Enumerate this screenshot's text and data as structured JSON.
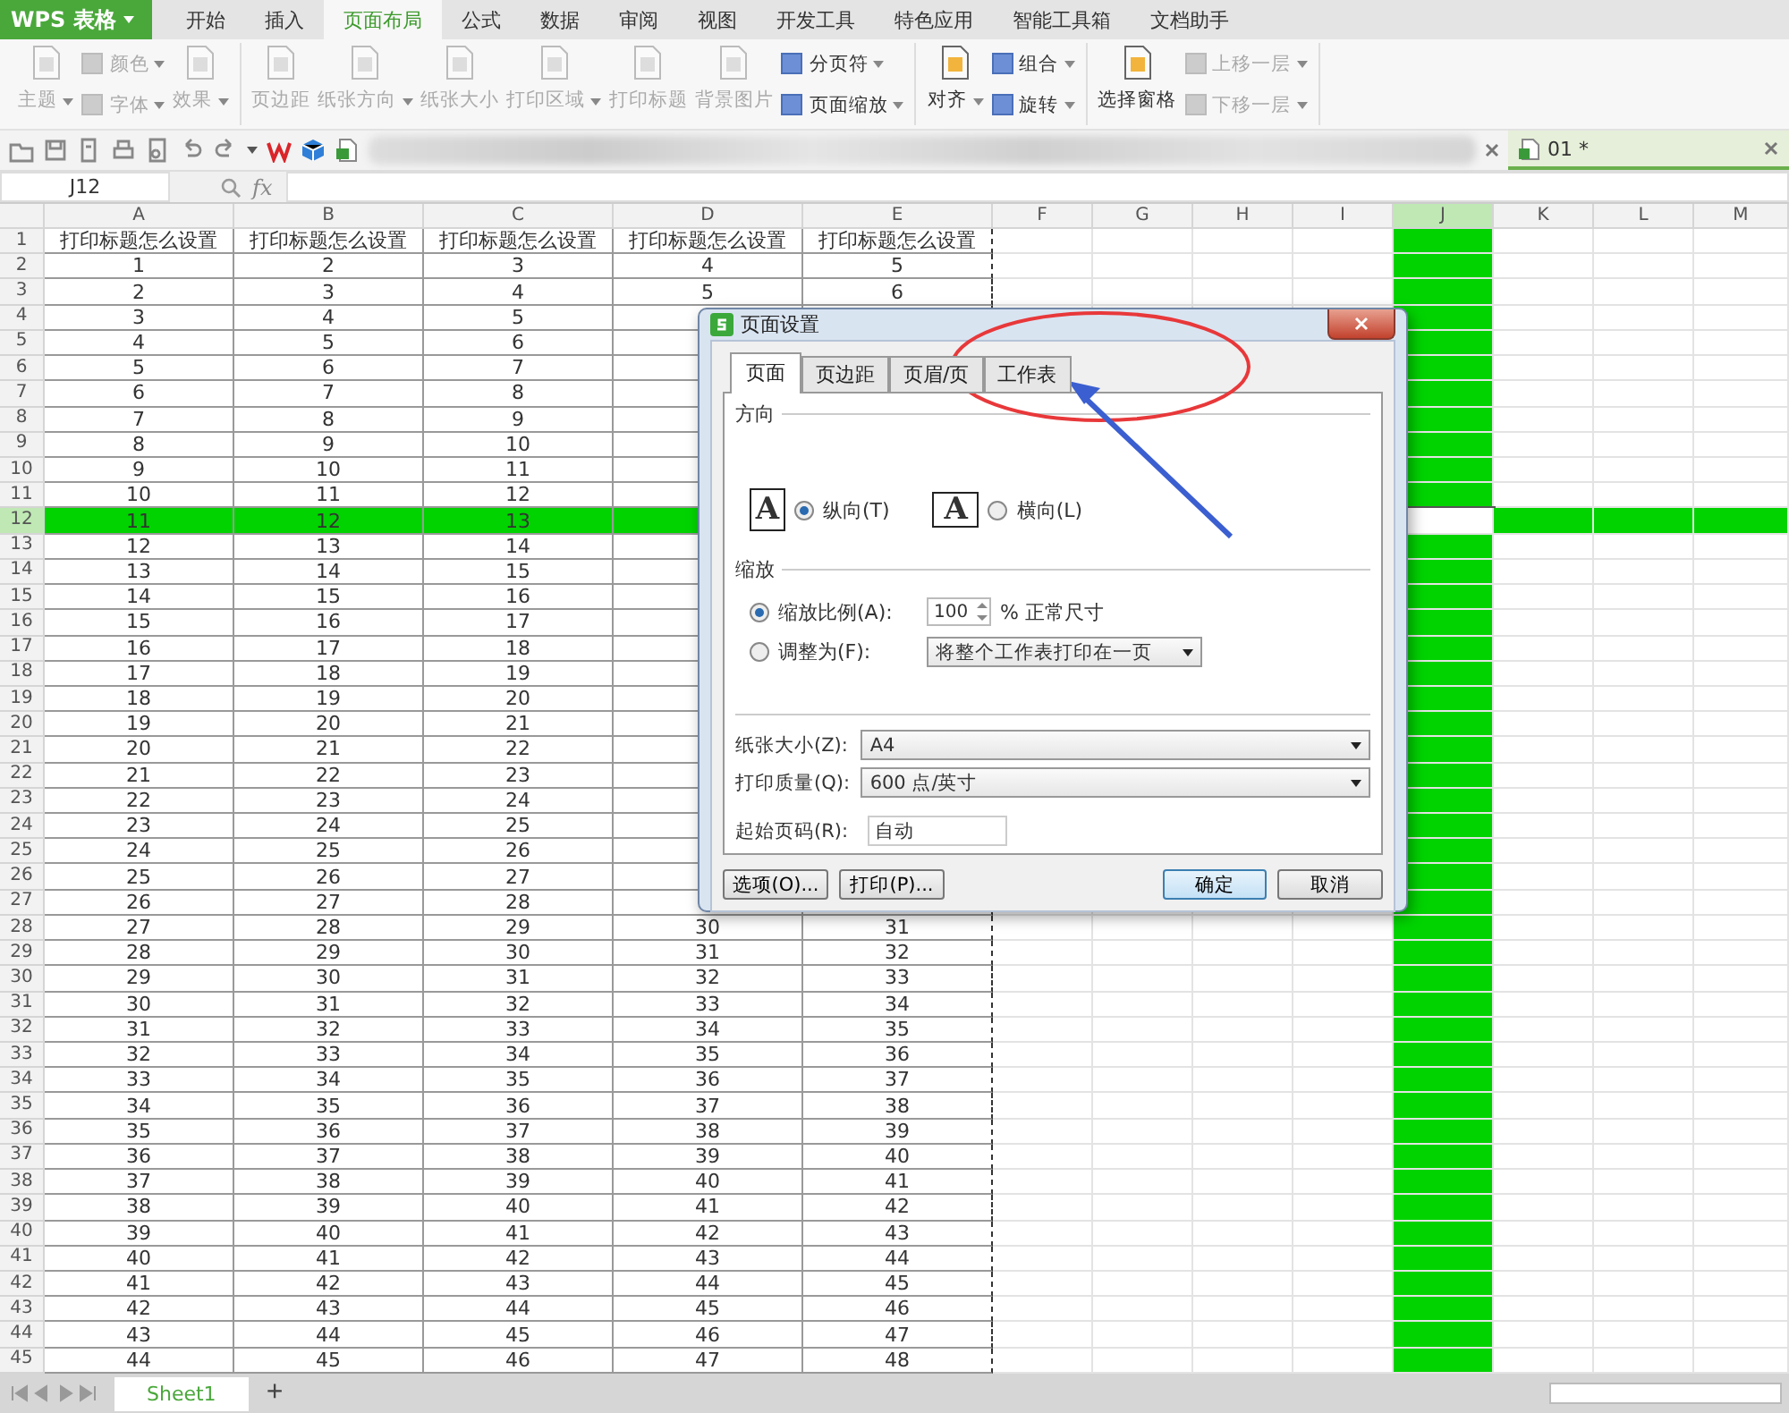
{
  "app_button": {
    "label": "WPS 表格"
  },
  "menu_tabs": [
    {
      "label": "开始",
      "selected": false
    },
    {
      "label": "插入",
      "selected": false
    },
    {
      "label": "页面布局",
      "selected": true
    },
    {
      "label": "公式",
      "selected": false
    },
    {
      "label": "数据",
      "selected": false
    },
    {
      "label": "审阅",
      "selected": false
    },
    {
      "label": "视图",
      "selected": false
    },
    {
      "label": "开发工具",
      "selected": false
    },
    {
      "label": "特色应用",
      "selected": false
    },
    {
      "label": "智能工具箱",
      "selected": false
    },
    {
      "label": "文档助手",
      "selected": false
    }
  ],
  "ribbon": {
    "groups": [
      {
        "columns": [
          [
            {
              "label": "主题",
              "disabled": true,
              "menu": true
            }
          ],
          [
            {
              "label": "颜色",
              "disabled": true,
              "menu": true
            },
            {
              "label": "字体",
              "disabled": true,
              "menu": true
            }
          ],
          [
            {
              "label": "效果",
              "disabled": true,
              "menu": true
            }
          ]
        ]
      },
      {
        "columns": [
          [
            {
              "label": "页边距",
              "disabled": true,
              "menu": false
            }
          ],
          [
            {
              "label": "纸张方向",
              "disabled": true,
              "menu": true
            }
          ],
          [
            {
              "label": "纸张大小",
              "disabled": true,
              "menu": false
            }
          ],
          [
            {
              "label": "打印区域",
              "disabled": true,
              "menu": true
            }
          ],
          [
            {
              "label": "打印标题",
              "disabled": true,
              "menu": false
            }
          ],
          [
            {
              "label": "背景图片",
              "disabled": true,
              "menu": false
            }
          ],
          [
            {
              "label": "分页符",
              "disabled": false,
              "menu": true
            },
            {
              "label": "页面缩放",
              "disabled": false,
              "menu": true
            }
          ]
        ]
      },
      {
        "columns": [
          [
            {
              "label": "对齐",
              "disabled": false,
              "menu": true
            }
          ],
          [
            {
              "label": "组合",
              "disabled": false,
              "menu": true
            },
            {
              "label": "旋转",
              "disabled": false,
              "menu": true
            }
          ]
        ]
      },
      {
        "columns": [
          [
            {
              "label": "选择窗格",
              "disabled": false,
              "menu": false
            }
          ],
          [
            {
              "label": "上移一层",
              "disabled": true,
              "menu": true
            },
            {
              "label": "下移一层",
              "disabled": true,
              "menu": true
            }
          ]
        ]
      }
    ]
  },
  "document_tab": {
    "label": "01 *"
  },
  "name_box": {
    "value": "J12"
  },
  "formula_bar": {
    "fx": "fx"
  },
  "sheet": {
    "columns": [
      {
        "label": "A",
        "selected": false
      },
      {
        "label": "B",
        "selected": false
      },
      {
        "label": "C",
        "selected": false
      },
      {
        "label": "D",
        "selected": false
      },
      {
        "label": "E",
        "selected": false
      },
      {
        "label": "F",
        "selected": false
      },
      {
        "label": "G",
        "selected": false
      },
      {
        "label": "H",
        "selected": false
      },
      {
        "label": "I",
        "selected": false
      },
      {
        "label": "J",
        "selected": true
      },
      {
        "label": "K",
        "selected": false
      },
      {
        "label": "L",
        "selected": false
      },
      {
        "label": "M",
        "selected": false
      }
    ],
    "rows": [
      {
        "header": "1",
        "selected": false,
        "cells": [
          "打印标题怎么设置",
          "打印标题怎么设置",
          "打印标题怎么设置",
          "打印标题怎么设置",
          "打印标题怎么设置"
        ]
      },
      {
        "header": "2",
        "selected": false,
        "cells": [
          "1",
          "2",
          "3",
          "4",
          "5"
        ]
      },
      {
        "header": "3",
        "selected": false,
        "cells": [
          "2",
          "3",
          "4",
          "5",
          "6"
        ]
      },
      {
        "header": "4",
        "selected": false,
        "cells": [
          "3",
          "4",
          "5"
        ]
      },
      {
        "header": "5",
        "selected": false,
        "cells": [
          "4",
          "5",
          "6"
        ]
      },
      {
        "header": "6",
        "selected": false,
        "cells": [
          "5",
          "6",
          "7"
        ]
      },
      {
        "header": "7",
        "selected": false,
        "cells": [
          "6",
          "7",
          "8"
        ]
      },
      {
        "header": "8",
        "selected": false,
        "cells": [
          "7",
          "8",
          "9"
        ]
      },
      {
        "header": "9",
        "selected": false,
        "cells": [
          "8",
          "9",
          "10"
        ]
      },
      {
        "header": "10",
        "selected": false,
        "cells": [
          "9",
          "10",
          "11"
        ]
      },
      {
        "header": "11",
        "selected": false,
        "cells": [
          "10",
          "11",
          "12"
        ]
      },
      {
        "header": "12",
        "selected": true,
        "cells": [
          "11",
          "12",
          "13"
        ]
      },
      {
        "header": "13",
        "selected": false,
        "cells": [
          "12",
          "13",
          "14"
        ]
      },
      {
        "header": "14",
        "selected": false,
        "cells": [
          "13",
          "14",
          "15"
        ]
      },
      {
        "header": "15",
        "selected": false,
        "cells": [
          "14",
          "15",
          "16"
        ]
      },
      {
        "header": "16",
        "selected": false,
        "cells": [
          "15",
          "16",
          "17"
        ]
      },
      {
        "header": "17",
        "selected": false,
        "cells": [
          "16",
          "17",
          "18"
        ]
      },
      {
        "header": "18",
        "selected": false,
        "cells": [
          "17",
          "18",
          "19"
        ]
      },
      {
        "header": "19",
        "selected": false,
        "cells": [
          "18",
          "19",
          "20"
        ]
      },
      {
        "header": "20",
        "selected": false,
        "cells": [
          "19",
          "20",
          "21"
        ]
      },
      {
        "header": "21",
        "selected": false,
        "cells": [
          "20",
          "21",
          "22"
        ]
      },
      {
        "header": "22",
        "selected": false,
        "cells": [
          "21",
          "22",
          "23"
        ]
      },
      {
        "header": "23",
        "selected": false,
        "cells": [
          "22",
          "23",
          "24"
        ]
      },
      {
        "header": "24",
        "selected": false,
        "cells": [
          "23",
          "24",
          "25"
        ]
      },
      {
        "header": "25",
        "selected": false,
        "cells": [
          "24",
          "25",
          "26"
        ]
      },
      {
        "header": "26",
        "selected": false,
        "cells": [
          "25",
          "26",
          "27"
        ]
      },
      {
        "header": "27",
        "selected": false,
        "cells": [
          "26",
          "27",
          "28"
        ]
      },
      {
        "header": "28",
        "selected": false,
        "cells": [
          "27",
          "28",
          "29",
          "30",
          "31"
        ]
      },
      {
        "header": "29",
        "selected": false,
        "cells": [
          "28",
          "29",
          "30",
          "31",
          "32"
        ]
      },
      {
        "header": "30",
        "selected": false,
        "cells": [
          "29",
          "30",
          "31",
          "32",
          "33"
        ]
      },
      {
        "header": "31",
        "selected": false,
        "cells": [
          "30",
          "31",
          "32",
          "33",
          "34"
        ]
      },
      {
        "header": "32",
        "selected": false,
        "cells": [
          "31",
          "32",
          "33",
          "34",
          "35"
        ]
      },
      {
        "header": "33",
        "selected": false,
        "cells": [
          "32",
          "33",
          "34",
          "35",
          "36"
        ]
      },
      {
        "header": "34",
        "selected": false,
        "cells": [
          "33",
          "34",
          "35",
          "36",
          "37"
        ]
      },
      {
        "header": "35",
        "selected": false,
        "cells": [
          "34",
          "35",
          "36",
          "37",
          "38"
        ]
      },
      {
        "header": "36",
        "selected": false,
        "cells": [
          "35",
          "36",
          "37",
          "38",
          "39"
        ]
      },
      {
        "header": "37",
        "selected": false,
        "cells": [
          "36",
          "37",
          "38",
          "39",
          "40"
        ]
      },
      {
        "header": "38",
        "selected": false,
        "cells": [
          "37",
          "38",
          "39",
          "40",
          "41"
        ]
      },
      {
        "header": "39",
        "selected": false,
        "cells": [
          "38",
          "39",
          "40",
          "41",
          "42"
        ]
      },
      {
        "header": "40",
        "selected": false,
        "cells": [
          "39",
          "40",
          "41",
          "42",
          "43"
        ]
      },
      {
        "header": "41",
        "selected": false,
        "cells": [
          "40",
          "41",
          "42",
          "43",
          "44"
        ]
      },
      {
        "header": "42",
        "selected": false,
        "cells": [
          "41",
          "42",
          "43",
          "44",
          "45"
        ]
      },
      {
        "header": "43",
        "selected": false,
        "cells": [
          "42",
          "43",
          "44",
          "45",
          "46"
        ]
      },
      {
        "header": "44",
        "selected": false,
        "cells": [
          "43",
          "44",
          "45",
          "46",
          "47"
        ]
      },
      {
        "header": "45",
        "selected": false,
        "cells": [
          "44",
          "45",
          "46",
          "47",
          "48"
        ]
      }
    ]
  },
  "dialog": {
    "title": "页面设置",
    "tabs": [
      {
        "label": "页面",
        "selected": true
      },
      {
        "label": "页边距",
        "selected": false
      },
      {
        "label": "页眉/页",
        "selected": false
      },
      {
        "label": "工作表",
        "selected": false
      }
    ],
    "orientation": {
      "title": "方向",
      "options": [
        {
          "glyph": "A",
          "label": "纵向(T)",
          "selected": true
        },
        {
          "glyph": "A",
          "label": "横向(L)",
          "selected": false
        }
      ]
    },
    "scaling": {
      "title": "缩放",
      "options": [
        {
          "label": "缩放比例(A):",
          "selected": true
        },
        {
          "label": "调整为(F):",
          "selected": false
        }
      ],
      "percent": "100",
      "percent_suffix": "% 正常尺寸",
      "fit": "将整个工作表打印在一页"
    },
    "fields": [
      {
        "label": "纸张大小(Z):",
        "value": "A4"
      },
      {
        "label": "打印质量(Q):",
        "value": "600 点/英寸"
      }
    ],
    "start_page": {
      "label": "起始页码(R):",
      "value": "自动"
    },
    "buttons": [
      {
        "label": "选项(O)...",
        "kind": "plain"
      },
      {
        "label": "打印(P)...",
        "kind": "plain"
      },
      {
        "label": "确定",
        "kind": "default"
      },
      {
        "label": "取消",
        "kind": "plain"
      }
    ]
  },
  "sheet_tabs": [
    {
      "label": "Sheet1",
      "selected": true
    }
  ],
  "add_sheet": {
    "label": "+"
  }
}
